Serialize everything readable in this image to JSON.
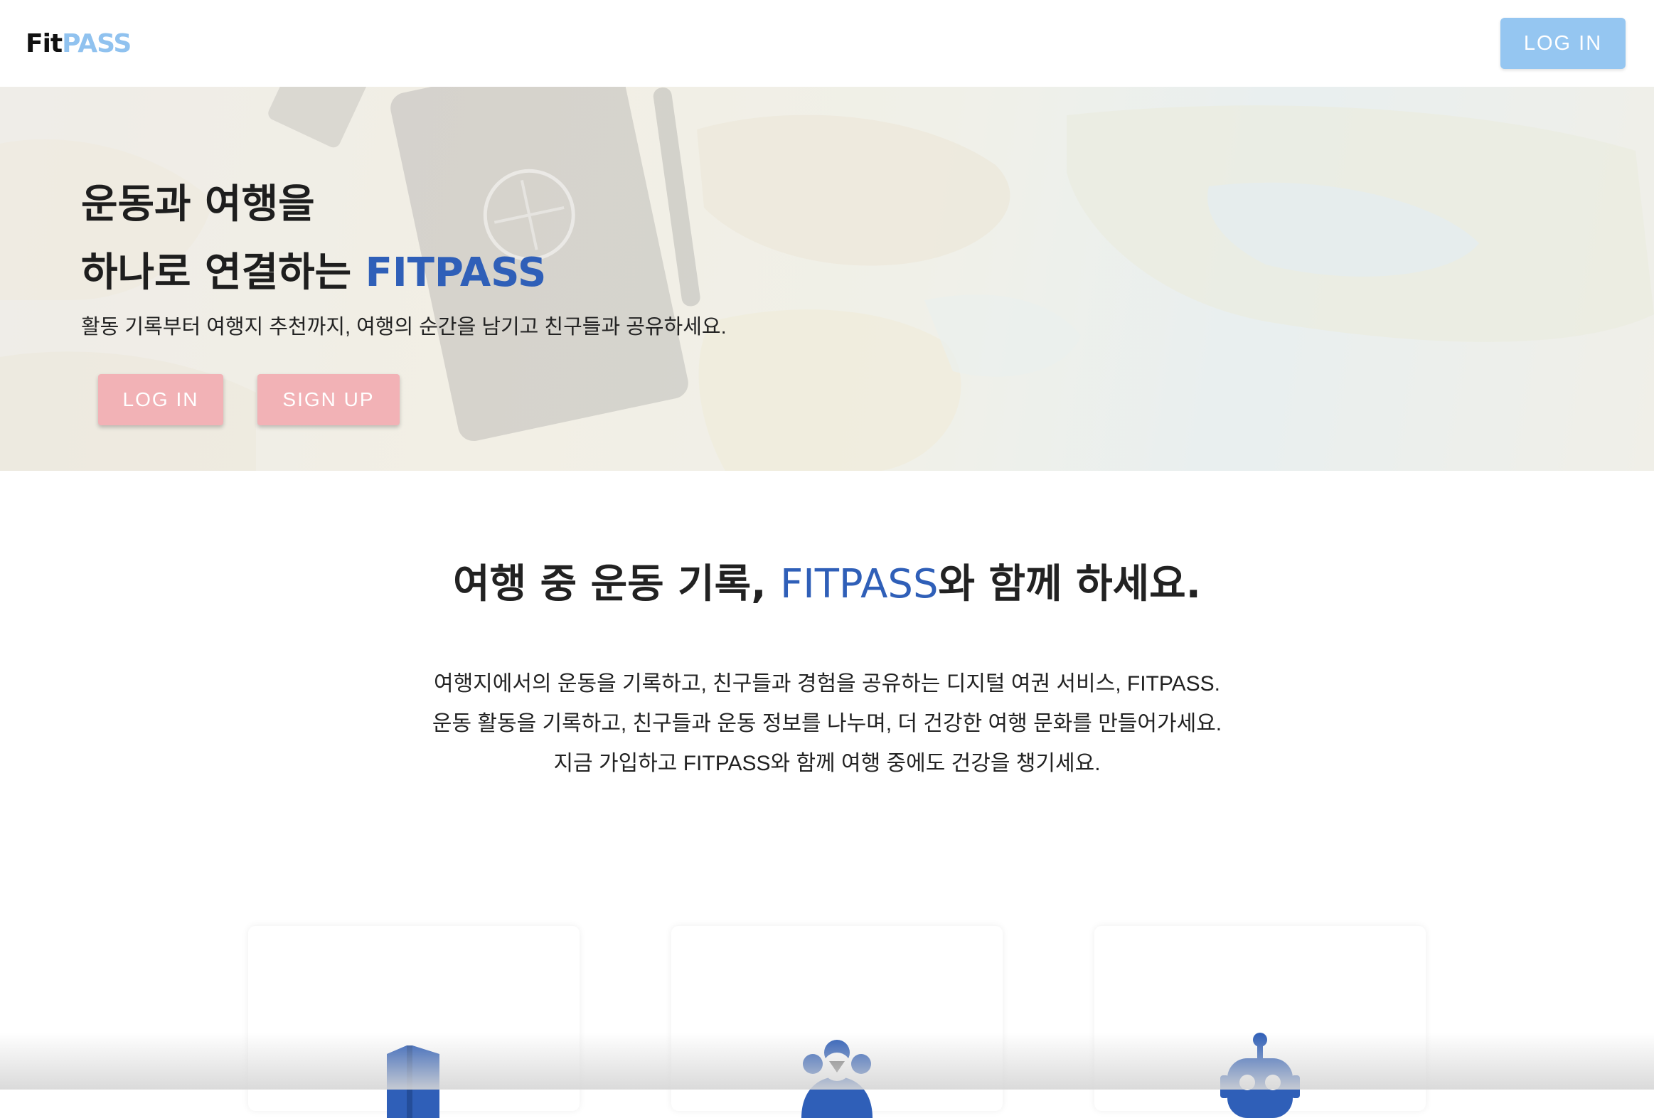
{
  "header": {
    "logo": {
      "part1": "Fit",
      "part2": "PASS"
    },
    "login_label": "LOG IN"
  },
  "hero": {
    "title_line1": "운동과 여행을",
    "title_line2_prefix": "하나로 연결하는 ",
    "title_line2_accent": "FITPASS",
    "subtitle": "활동 기록부터 여행지 추천까지, 여행의 순간을 남기고 친구들과 공유하세요.",
    "login_label": "LOG IN",
    "signup_label": "SIGN UP",
    "background_image": "world-map-with-passport"
  },
  "intro": {
    "heading_prefix": "여행 중 운동 기록, ",
    "heading_accent": "FITPASS",
    "heading_suffix": "와 함께 하세요.",
    "lines": [
      "여행지에서의 운동을 기록하고, 친구들과 경험을 공유하는 디지털 여권 서비스, FITPASS.",
      "운동 활동을 기록하고, 친구들과 운동 정보를 나누며, 더 건강한 여행 문화를 만들어가세요.",
      "지금 가입하고 FITPASS와 함께 여행 중에도 건강을 챙기세요."
    ]
  },
  "features": [
    {
      "icon": "map-icon"
    },
    {
      "icon": "friends-icon"
    },
    {
      "icon": "robot-icon"
    }
  ],
  "colors": {
    "accent_blue": "#2f5fb8",
    "logo_light_blue": "#90c2ef",
    "header_button": "#95c6f1",
    "hero_button": "#f2b2b6"
  }
}
